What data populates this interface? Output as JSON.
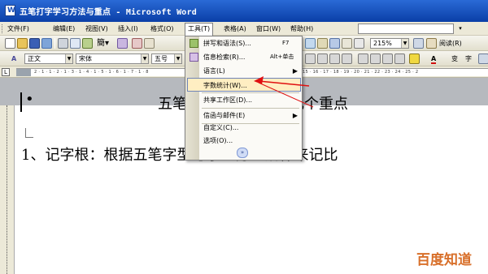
{
  "window": {
    "title": "五笔打字学习方法与重点 - Microsoft Word"
  },
  "menubar": {
    "items": [
      {
        "label": "文件(F)"
      },
      {
        "label": "编辑(E)"
      },
      {
        "label": "视图(V)"
      },
      {
        "label": "插入(I)"
      },
      {
        "label": "格式(O)"
      },
      {
        "label": "工具(T)"
      },
      {
        "label": "表格(A)"
      },
      {
        "label": "窗口(W)"
      },
      {
        "label": "帮助(H)"
      }
    ]
  },
  "toolbar": {
    "zoom_value": "215%",
    "reading_label": "阅读(R)",
    "style_value": "正文",
    "font_value": "宋体",
    "size_value": "五号"
  },
  "ruler": {
    "ticks": "2 · 1 · 1 · 2 · 1 · 3 · 1 · 4 · 1 · 5 · 1 · 6 · 1 · 7 · 1 · 8",
    "right_ticks": "15 · 16 · 17 · 18 · 19 · 20 · 21 · 22 · 23 · 24 · 25 · 2"
  },
  "tools_menu": {
    "items": [
      {
        "label": "拼写和语法(S)...",
        "shortcut": "F7"
      },
      {
        "label": "信息检索(R)...",
        "shortcut": "Alt+单击"
      },
      {
        "label": "语言(L)"
      },
      {
        "label": "字数统计(W)..."
      },
      {
        "label": "共享工作区(D)..."
      },
      {
        "label": "信函与邮件(E)"
      },
      {
        "label": "自定义(C)..."
      },
      {
        "label": "选项(O)..."
      }
    ],
    "more_glyph": "»"
  },
  "document": {
    "bullet": "•",
    "heading": "五笔打字练习方法与几个重点",
    "line1": "1、记字根：根据五笔字型与字型分区规律来记比"
  },
  "watermark": "百度知道",
  "colors": {
    "titlebar": "#0a3fa7",
    "menu_highlight": "#ffeec2",
    "annotation": "#e01010",
    "watermark": "#d86f2a"
  }
}
